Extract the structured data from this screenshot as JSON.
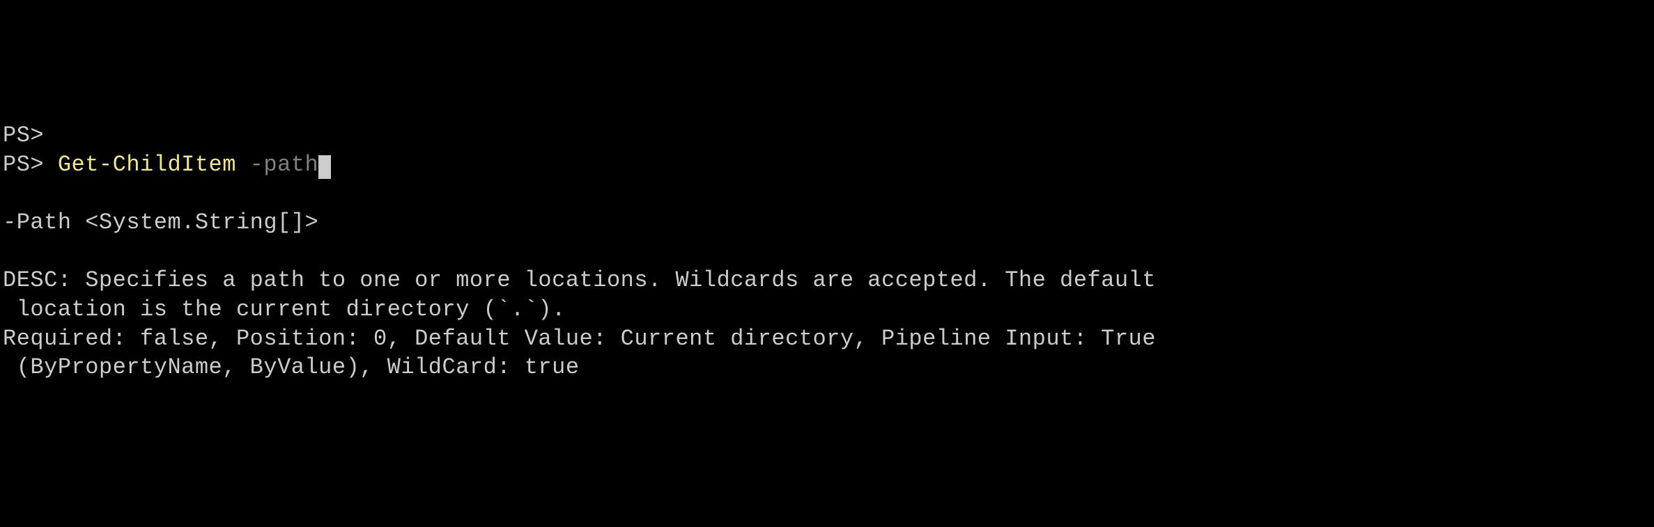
{
  "lines": {
    "prompt_empty": "PS>",
    "prompt_cmd": "PS> ",
    "command": "Get-ChildItem",
    "space": " ",
    "param": "-path"
  },
  "help": {
    "signature": "-Path <System.String[]>",
    "desc_line1": "DESC: Specifies a path to one or more locations. Wildcards are accepted. The default",
    "desc_line2": " location is the current directory (`.`).",
    "meta_line1": "Required: false, Position: 0, Default Value: Current directory, Pipeline Input: True",
    "meta_line2": " (ByPropertyName, ByValue), WildCard: true"
  }
}
